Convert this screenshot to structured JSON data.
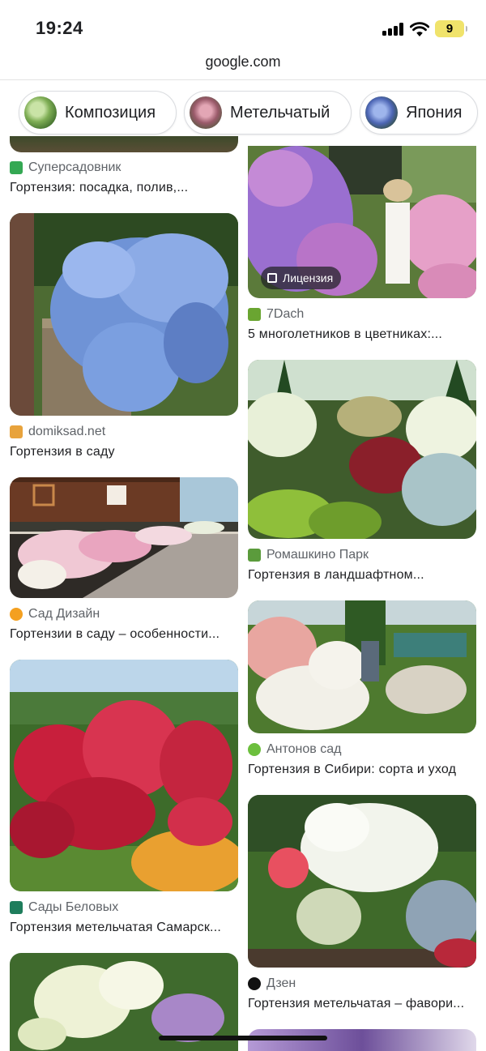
{
  "status_bar": {
    "time": "19:24",
    "battery": "9"
  },
  "browser": {
    "url": "google.com"
  },
  "chips": [
    {
      "label": "Композиция",
      "icon": "hydrangea-green-thumb"
    },
    {
      "label": "Метельчатый",
      "icon": "hydrangea-pink-thumb"
    },
    {
      "label": "Япония",
      "icon": "hydrangea-blue-thumb"
    }
  ],
  "results_left": [
    {
      "source": "Суперсадовник",
      "title": "Гортензия: посадка, полив,...",
      "favicon_color": "#34a853"
    },
    {
      "source": "domiksad.net",
      "title": "Гортензия в саду",
      "favicon_color": "#e8a33c"
    },
    {
      "source": "Сад Дизайн",
      "title": "Гортензии в саду – особенности...",
      "favicon_color": "#f4a020"
    },
    {
      "source": "Сады Беловых",
      "title": "Гортензия метельчатая Самарск...",
      "favicon_color": "#1e7d5c"
    }
  ],
  "results_right": [
    {
      "source": "7Dach",
      "title": "5 многолетников в цветниках:...",
      "favicon_color": "#6aa531",
      "badge": "Лицензия"
    },
    {
      "source": "Ромашкино Парк",
      "title": "Гортензия в ландшафтном...",
      "favicon_color": "#5b9b3c"
    },
    {
      "source": "Антонов сад",
      "title": "Гортензия в Сибири: сорта и уход",
      "favicon_color": "#6cbf3d"
    },
    {
      "source": "Дзен",
      "title": "Гортензия метельчатая – фавори...",
      "favicon_color": "#111111"
    }
  ]
}
